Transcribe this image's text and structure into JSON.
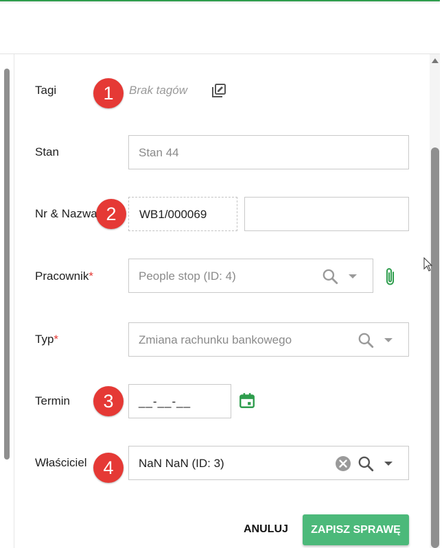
{
  "form": {
    "tags": {
      "label": "Tagi",
      "value": "Brak tagów",
      "badge": "1"
    },
    "stan": {
      "label": "Stan",
      "value": "Stan 44"
    },
    "nr_nazwa": {
      "label": "Nr & Nazwa",
      "number": "WB1/000069",
      "name": "",
      "badge": "2"
    },
    "pracownik": {
      "label": "Pracownik",
      "required_mark": "*",
      "value": "People stop (ID: 4)"
    },
    "typ": {
      "label": "Typ",
      "required_mark": "*",
      "value": "Zmiana rachunku bankowego"
    },
    "termin": {
      "label": "Termin",
      "value": "__-__-__",
      "badge": "3"
    },
    "wlasciciel": {
      "label": "Właściciel",
      "value": "NaN NaN (ID: 3)",
      "badge": "4"
    }
  },
  "actions": {
    "cancel_label": "ANULUJ",
    "save_label": "ZAPISZ SPRAWĘ"
  },
  "colors": {
    "accent_green": "#2e9d4d",
    "save_button": "#4cb97a",
    "badge_red": "#e53935",
    "required_red": "#e53935"
  },
  "icons": [
    "edit-tags-icon",
    "search-icon",
    "chevron-down-icon",
    "paperclip-icon",
    "calendar-icon",
    "clear-icon"
  ]
}
